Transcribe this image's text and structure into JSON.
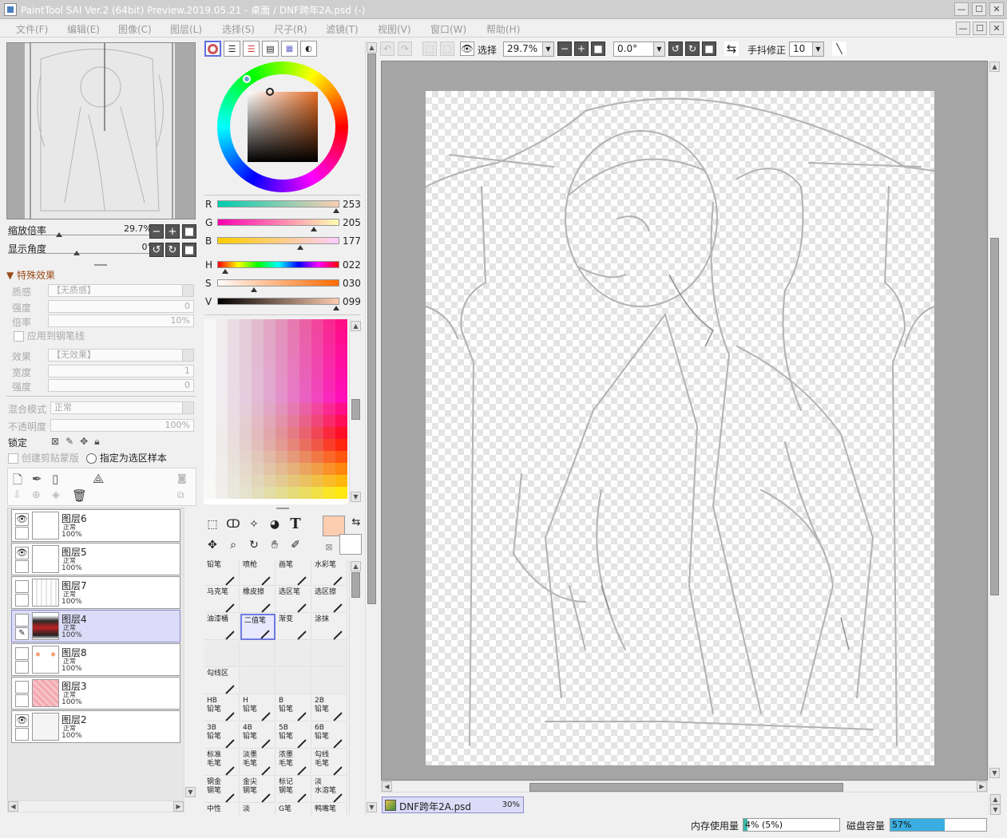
{
  "window": {
    "title": "PaintTool SAI Ver.2 (64bit) Preview.2019.05.21 - 桌面 / DNF跨年2A.psd (-)",
    "minimize": "—",
    "maximize": "☐",
    "close": "✕"
  },
  "menu": [
    "文件(F)",
    "编辑(E)",
    "图像(C)",
    "图层(L)",
    "选择(S)",
    "尺子(R)",
    "滤镜(T)",
    "视图(V)",
    "窗口(W)",
    "帮助(H)"
  ],
  "navigator": {
    "zoom_label": "缩放倍率",
    "zoom_value": "29.7%",
    "angle_label": "显示角度",
    "angle_value": "0°"
  },
  "effects": {
    "header": "特殊效果",
    "texture_label": "质感",
    "texture_value": "【无质感】",
    "strength_label": "强度",
    "strength_value": "0",
    "scale_label": "倍率",
    "scale_value": "10%",
    "apply_pen_label": "应用到钢笔线",
    "effect_label": "效果",
    "effect_value": "【无效果】",
    "width_label": "宽度",
    "width_value": "1",
    "strength2_label": "强度",
    "strength2_value": "0"
  },
  "layer_props": {
    "blend_label": "混合模式",
    "blend_value": "正常",
    "opacity_label": "不透明度",
    "opacity_value": "100%",
    "lock_label": "锁定",
    "clip_label": "创建剪贴蒙版",
    "sample_label": "指定为选区样本"
  },
  "layers": [
    {
      "name": "图层6",
      "mode": "正常",
      "opacity": "100%",
      "visible": true,
      "selected": false,
      "thumb": "blank"
    },
    {
      "name": "图层5",
      "mode": "正常",
      "opacity": "100%",
      "visible": true,
      "selected": false,
      "thumb": "blank"
    },
    {
      "name": "图层7",
      "mode": "正常",
      "opacity": "100%",
      "visible": false,
      "selected": false,
      "thumb": "sketch"
    },
    {
      "name": "图层4",
      "mode": "正常",
      "opacity": "100%",
      "visible": false,
      "selected": true,
      "thumb": "figure"
    },
    {
      "name": "图层8",
      "mode": "正常",
      "opacity": "100%",
      "visible": false,
      "selected": false,
      "thumb": "dots"
    },
    {
      "name": "图层3",
      "mode": "正常",
      "opacity": "100%",
      "visible": false,
      "selected": false,
      "thumb": "pink"
    },
    {
      "name": "图层2",
      "mode": "正常",
      "opacity": "100%",
      "visible": true,
      "selected": false,
      "thumb": "faint"
    }
  ],
  "color": {
    "r_label": "R",
    "r": "253",
    "g_label": "G",
    "g": "205",
    "b_label": "B",
    "b": "177",
    "h_label": "H",
    "h": "022",
    "s_label": "S",
    "s": "030",
    "v_label": "V",
    "v": "099",
    "fg": "#fdcdb1",
    "bg": "#ffffff"
  },
  "tools": {
    "text_tool": "T"
  },
  "brushes": [
    {
      "name": "铅笔",
      "name2": ""
    },
    {
      "name": "喷枪",
      "name2": ""
    },
    {
      "name": "画笔",
      "name2": ""
    },
    {
      "name": "水彩笔",
      "name2": ""
    },
    {
      "name": "马克笔",
      "name2": ""
    },
    {
      "name": "橡皮擦",
      "name2": ""
    },
    {
      "name": "选区笔",
      "name2": ""
    },
    {
      "name": "选区擦",
      "name2": ""
    },
    {
      "name": "油漆桶",
      "name2": ""
    },
    {
      "name": "二值笔",
      "name2": ""
    },
    {
      "name": "渐变",
      "name2": ""
    },
    {
      "name": "涂抹",
      "name2": ""
    },
    {
      "name": "",
      "name2": ""
    },
    {
      "name": "",
      "name2": ""
    },
    {
      "name": "",
      "name2": ""
    },
    {
      "name": "",
      "name2": ""
    },
    {
      "name": "勾线区",
      "name2": ""
    },
    {
      "name": "",
      "name2": ""
    },
    {
      "name": "",
      "name2": ""
    },
    {
      "name": "",
      "name2": ""
    },
    {
      "name": "HB",
      "name2": "铅笔"
    },
    {
      "name": "H",
      "name2": "铅笔"
    },
    {
      "name": "B",
      "name2": "铅笔"
    },
    {
      "name": "2B",
      "name2": "铅笔"
    },
    {
      "name": "3B",
      "name2": "铅笔"
    },
    {
      "name": "4B",
      "name2": "铅笔"
    },
    {
      "name": "5B",
      "name2": "铅笔"
    },
    {
      "name": "6B",
      "name2": "铅笔"
    },
    {
      "name": "标准",
      "name2": "毛笔"
    },
    {
      "name": "淡墨",
      "name2": "毛笔"
    },
    {
      "name": "浓墨",
      "name2": "毛笔"
    },
    {
      "name": "勾线",
      "name2": "毛笔"
    },
    {
      "name": "钢金",
      "name2": "钢笔"
    },
    {
      "name": "金尖",
      "name2": "钢笔"
    },
    {
      "name": "标记",
      "name2": "钢笔"
    },
    {
      "name": "淡",
      "name2": "水溶笔"
    },
    {
      "name": "中性",
      "name2": ""
    },
    {
      "name": "淡",
      "name2": ""
    },
    {
      "name": "G笔",
      "name2": ""
    },
    {
      "name": "鸭嘴笔",
      "name2": ""
    }
  ],
  "toolbar": {
    "select_label": "选择",
    "zoom": "29.7%",
    "angle": "0.0°",
    "stabilizer_label": "手抖修正",
    "stabilizer_value": "10"
  },
  "document": {
    "tab_name": "DNF跨年2A.psd",
    "tab_zoom": "30%"
  },
  "status": {
    "memory_label": "内存使用量",
    "memory_text": "4% (5%)",
    "memory_pct": 4,
    "disk_label": "磁盘容量",
    "disk_text": "57%",
    "disk_pct": 57
  }
}
